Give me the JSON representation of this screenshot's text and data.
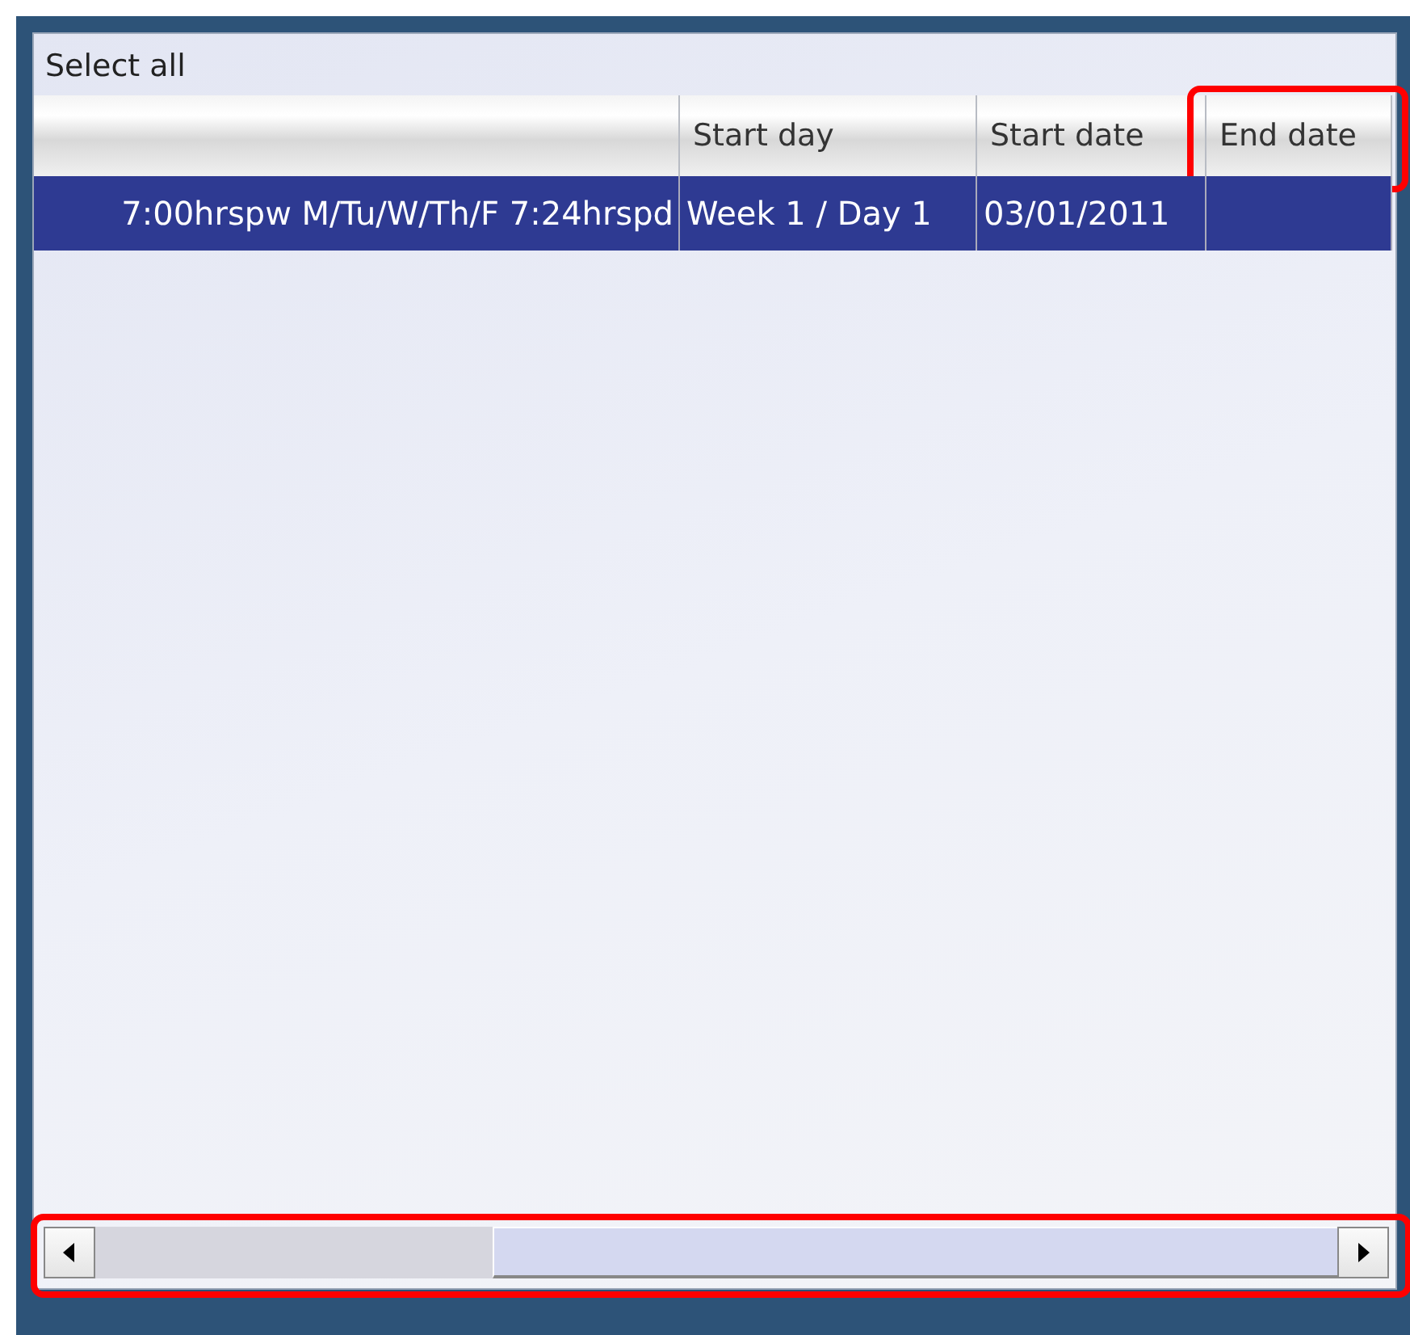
{
  "select_all": {
    "label": "Select all"
  },
  "columns": [
    {
      "highlighted": false
    },
    {
      "label": "Start day",
      "highlighted": false
    },
    {
      "label": "Start date",
      "highlighted": false
    },
    {
      "label": "End date",
      "highlighted": true
    }
  ],
  "rows": [
    {
      "selected": true,
      "cells": [
        "7:00hrspw M/Tu/W/Th/F 7:24hrspd",
        "Week 1 / Day 1",
        "03/01/2011",
        ""
      ]
    }
  ],
  "scrollbar": {
    "highlighted": true
  }
}
